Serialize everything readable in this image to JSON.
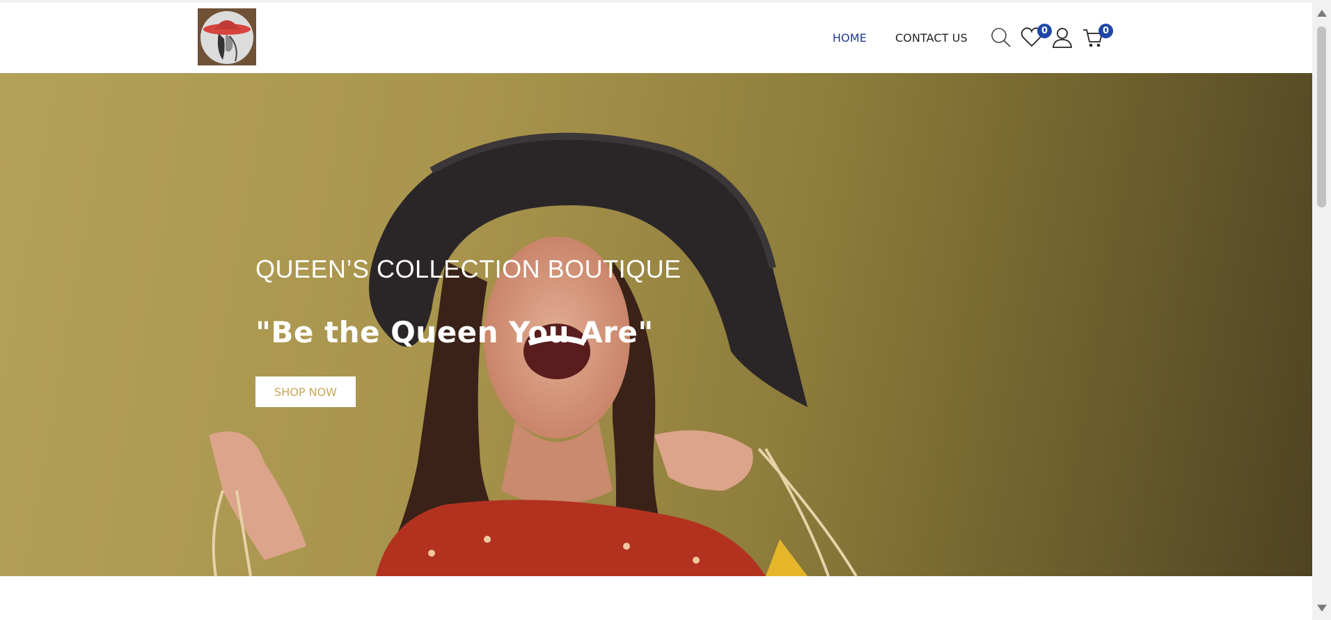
{
  "nav": {
    "logo_alt": "Queen's Collection Boutique logo",
    "links": [
      {
        "label": "HOME",
        "active": true
      },
      {
        "label": "CONTACT US",
        "active": false
      }
    ],
    "icons": {
      "search": "search-icon",
      "wishlist": "heart-icon",
      "account": "user-icon",
      "cart": "cart-icon"
    },
    "wishlist_count": "0",
    "cart_count": "0",
    "active_color": "#1f3b8a",
    "badge_color": "#1f47a8"
  },
  "hero": {
    "kicker": "QUEEN’S COLLECTION BOUTIQUE",
    "title": "\"Be the Queen You Are\"",
    "cta_label": "SHOP NOW",
    "cta_text_color": "#c8a654",
    "background_color": "#a8944c"
  }
}
